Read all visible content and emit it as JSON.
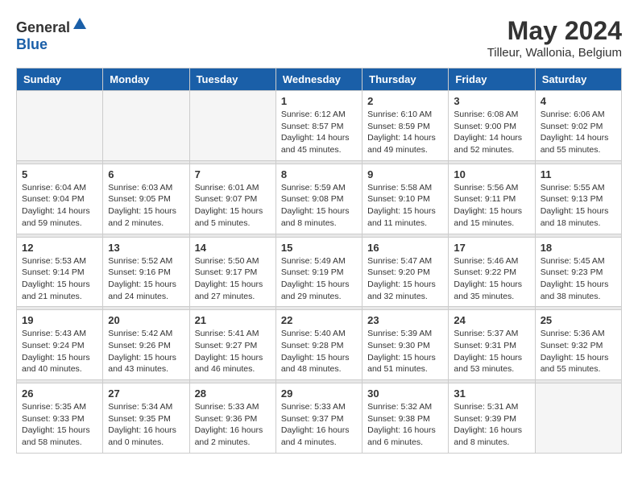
{
  "header": {
    "logo_general": "General",
    "logo_blue": "Blue",
    "month_year": "May 2024",
    "location": "Tilleur, Wallonia, Belgium"
  },
  "days_of_week": [
    "Sunday",
    "Monday",
    "Tuesday",
    "Wednesday",
    "Thursday",
    "Friday",
    "Saturday"
  ],
  "weeks": [
    [
      {
        "day": "",
        "info": ""
      },
      {
        "day": "",
        "info": ""
      },
      {
        "day": "",
        "info": ""
      },
      {
        "day": "1",
        "info": "Sunrise: 6:12 AM\nSunset: 8:57 PM\nDaylight: 14 hours\nand 45 minutes."
      },
      {
        "day": "2",
        "info": "Sunrise: 6:10 AM\nSunset: 8:59 PM\nDaylight: 14 hours\nand 49 minutes."
      },
      {
        "day": "3",
        "info": "Sunrise: 6:08 AM\nSunset: 9:00 PM\nDaylight: 14 hours\nand 52 minutes."
      },
      {
        "day": "4",
        "info": "Sunrise: 6:06 AM\nSunset: 9:02 PM\nDaylight: 14 hours\nand 55 minutes."
      }
    ],
    [
      {
        "day": "5",
        "info": "Sunrise: 6:04 AM\nSunset: 9:04 PM\nDaylight: 14 hours\nand 59 minutes."
      },
      {
        "day": "6",
        "info": "Sunrise: 6:03 AM\nSunset: 9:05 PM\nDaylight: 15 hours\nand 2 minutes."
      },
      {
        "day": "7",
        "info": "Sunrise: 6:01 AM\nSunset: 9:07 PM\nDaylight: 15 hours\nand 5 minutes."
      },
      {
        "day": "8",
        "info": "Sunrise: 5:59 AM\nSunset: 9:08 PM\nDaylight: 15 hours\nand 8 minutes."
      },
      {
        "day": "9",
        "info": "Sunrise: 5:58 AM\nSunset: 9:10 PM\nDaylight: 15 hours\nand 11 minutes."
      },
      {
        "day": "10",
        "info": "Sunrise: 5:56 AM\nSunset: 9:11 PM\nDaylight: 15 hours\nand 15 minutes."
      },
      {
        "day": "11",
        "info": "Sunrise: 5:55 AM\nSunset: 9:13 PM\nDaylight: 15 hours\nand 18 minutes."
      }
    ],
    [
      {
        "day": "12",
        "info": "Sunrise: 5:53 AM\nSunset: 9:14 PM\nDaylight: 15 hours\nand 21 minutes."
      },
      {
        "day": "13",
        "info": "Sunrise: 5:52 AM\nSunset: 9:16 PM\nDaylight: 15 hours\nand 24 minutes."
      },
      {
        "day": "14",
        "info": "Sunrise: 5:50 AM\nSunset: 9:17 PM\nDaylight: 15 hours\nand 27 minutes."
      },
      {
        "day": "15",
        "info": "Sunrise: 5:49 AM\nSunset: 9:19 PM\nDaylight: 15 hours\nand 29 minutes."
      },
      {
        "day": "16",
        "info": "Sunrise: 5:47 AM\nSunset: 9:20 PM\nDaylight: 15 hours\nand 32 minutes."
      },
      {
        "day": "17",
        "info": "Sunrise: 5:46 AM\nSunset: 9:22 PM\nDaylight: 15 hours\nand 35 minutes."
      },
      {
        "day": "18",
        "info": "Sunrise: 5:45 AM\nSunset: 9:23 PM\nDaylight: 15 hours\nand 38 minutes."
      }
    ],
    [
      {
        "day": "19",
        "info": "Sunrise: 5:43 AM\nSunset: 9:24 PM\nDaylight: 15 hours\nand 40 minutes."
      },
      {
        "day": "20",
        "info": "Sunrise: 5:42 AM\nSunset: 9:26 PM\nDaylight: 15 hours\nand 43 minutes."
      },
      {
        "day": "21",
        "info": "Sunrise: 5:41 AM\nSunset: 9:27 PM\nDaylight: 15 hours\nand 46 minutes."
      },
      {
        "day": "22",
        "info": "Sunrise: 5:40 AM\nSunset: 9:28 PM\nDaylight: 15 hours\nand 48 minutes."
      },
      {
        "day": "23",
        "info": "Sunrise: 5:39 AM\nSunset: 9:30 PM\nDaylight: 15 hours\nand 51 minutes."
      },
      {
        "day": "24",
        "info": "Sunrise: 5:37 AM\nSunset: 9:31 PM\nDaylight: 15 hours\nand 53 minutes."
      },
      {
        "day": "25",
        "info": "Sunrise: 5:36 AM\nSunset: 9:32 PM\nDaylight: 15 hours\nand 55 minutes."
      }
    ],
    [
      {
        "day": "26",
        "info": "Sunrise: 5:35 AM\nSunset: 9:33 PM\nDaylight: 15 hours\nand 58 minutes."
      },
      {
        "day": "27",
        "info": "Sunrise: 5:34 AM\nSunset: 9:35 PM\nDaylight: 16 hours\nand 0 minutes."
      },
      {
        "day": "28",
        "info": "Sunrise: 5:33 AM\nSunset: 9:36 PM\nDaylight: 16 hours\nand 2 minutes."
      },
      {
        "day": "29",
        "info": "Sunrise: 5:33 AM\nSunset: 9:37 PM\nDaylight: 16 hours\nand 4 minutes."
      },
      {
        "day": "30",
        "info": "Sunrise: 5:32 AM\nSunset: 9:38 PM\nDaylight: 16 hours\nand 6 minutes."
      },
      {
        "day": "31",
        "info": "Sunrise: 5:31 AM\nSunset: 9:39 PM\nDaylight: 16 hours\nand 8 minutes."
      },
      {
        "day": "",
        "info": ""
      }
    ]
  ]
}
